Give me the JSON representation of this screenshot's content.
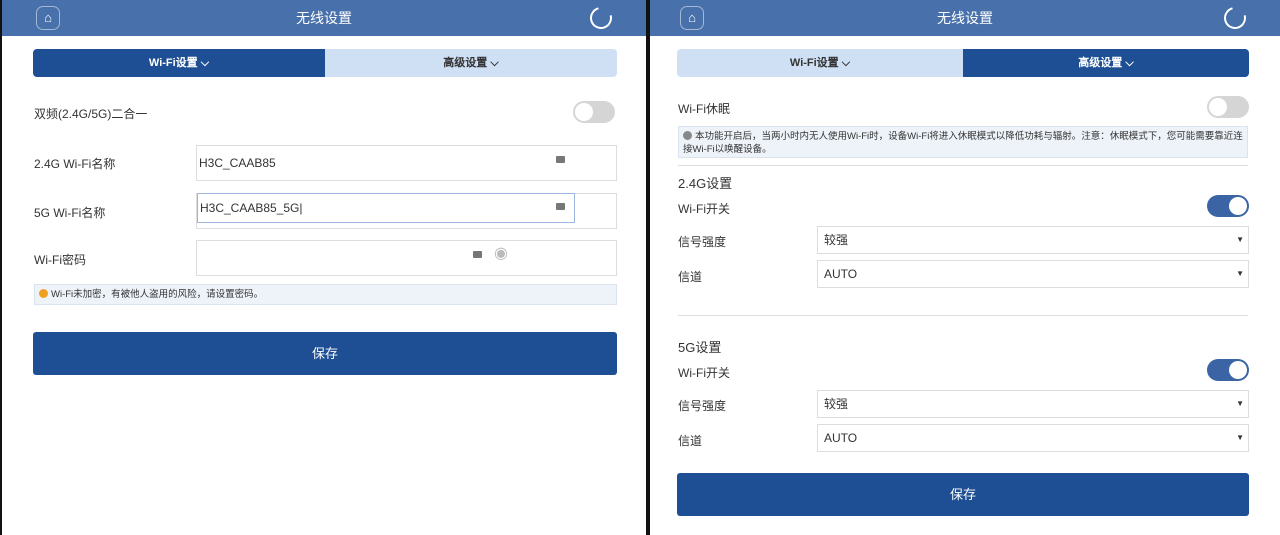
{
  "left": {
    "title": "无线设置",
    "tabs": [
      "Wi-Fi设置",
      "高级设置"
    ],
    "dual_band_label": "双频(2.4G/5G)二合一",
    "dual_band_on": false,
    "ssid24_label": "2.4G Wi-Fi名称",
    "ssid24_value": "H3C_CAAB85",
    "ssid5_label": "5G Wi-Fi名称",
    "ssid5_value": "H3C_CAAB85_5G",
    "password_label": "Wi-Fi密码",
    "password_value": "",
    "warning": "Wi-Fi未加密，有被他人盗用的风险，请设置密码。",
    "save": "保存"
  },
  "right": {
    "title": "无线设置",
    "tabs": [
      "Wi-Fi设置",
      "高级设置"
    ],
    "sleep_label": "Wi-Fi休眠",
    "sleep_on": false,
    "sleep_note": "本功能开启后，当两小时内无人使用Wi-Fi时，设备Wi-Fi将进入休眠模式以降低功耗与辐射。注意：休眠模式下，您可能需要靠近连接Wi-Fi以唤醒设备。",
    "g24": {
      "heading": "2.4G设置",
      "switch_label": "Wi-Fi开关",
      "switch_on": true,
      "signal_label": "信号强度",
      "signal_value": "较强",
      "channel_label": "信道",
      "channel_value": "AUTO"
    },
    "g5": {
      "heading": "5G设置",
      "switch_label": "Wi-Fi开关",
      "switch_on": true,
      "signal_label": "信号强度",
      "signal_value": "较强",
      "channel_label": "信道",
      "channel_value": "AUTO"
    },
    "save": "保存"
  },
  "colors": {
    "header": "#4870aa",
    "primary": "#1e4e93",
    "tab_inactive": "#cfe0f5",
    "warning": "#f0a020"
  }
}
